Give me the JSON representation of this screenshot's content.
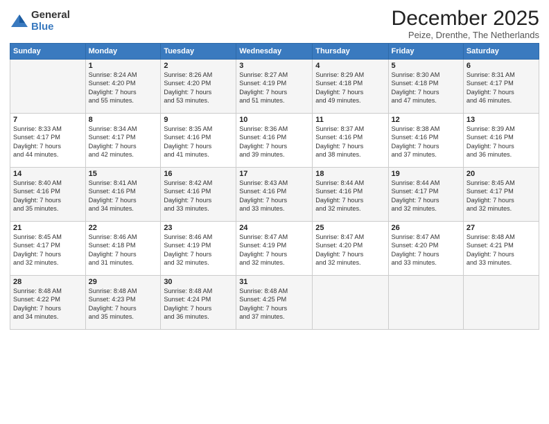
{
  "logo": {
    "general": "General",
    "blue": "Blue"
  },
  "title": "December 2025",
  "location": "Peize, Drenthe, The Netherlands",
  "days_header": [
    "Sunday",
    "Monday",
    "Tuesday",
    "Wednesday",
    "Thursday",
    "Friday",
    "Saturday"
  ],
  "weeks": [
    [
      {
        "day": "",
        "info": ""
      },
      {
        "day": "1",
        "info": "Sunrise: 8:24 AM\nSunset: 4:20 PM\nDaylight: 7 hours\nand 55 minutes."
      },
      {
        "day": "2",
        "info": "Sunrise: 8:26 AM\nSunset: 4:20 PM\nDaylight: 7 hours\nand 53 minutes."
      },
      {
        "day": "3",
        "info": "Sunrise: 8:27 AM\nSunset: 4:19 PM\nDaylight: 7 hours\nand 51 minutes."
      },
      {
        "day": "4",
        "info": "Sunrise: 8:29 AM\nSunset: 4:18 PM\nDaylight: 7 hours\nand 49 minutes."
      },
      {
        "day": "5",
        "info": "Sunrise: 8:30 AM\nSunset: 4:18 PM\nDaylight: 7 hours\nand 47 minutes."
      },
      {
        "day": "6",
        "info": "Sunrise: 8:31 AM\nSunset: 4:17 PM\nDaylight: 7 hours\nand 46 minutes."
      }
    ],
    [
      {
        "day": "7",
        "info": "Sunrise: 8:33 AM\nSunset: 4:17 PM\nDaylight: 7 hours\nand 44 minutes."
      },
      {
        "day": "8",
        "info": "Sunrise: 8:34 AM\nSunset: 4:17 PM\nDaylight: 7 hours\nand 42 minutes."
      },
      {
        "day": "9",
        "info": "Sunrise: 8:35 AM\nSunset: 4:16 PM\nDaylight: 7 hours\nand 41 minutes."
      },
      {
        "day": "10",
        "info": "Sunrise: 8:36 AM\nSunset: 4:16 PM\nDaylight: 7 hours\nand 39 minutes."
      },
      {
        "day": "11",
        "info": "Sunrise: 8:37 AM\nSunset: 4:16 PM\nDaylight: 7 hours\nand 38 minutes."
      },
      {
        "day": "12",
        "info": "Sunrise: 8:38 AM\nSunset: 4:16 PM\nDaylight: 7 hours\nand 37 minutes."
      },
      {
        "day": "13",
        "info": "Sunrise: 8:39 AM\nSunset: 4:16 PM\nDaylight: 7 hours\nand 36 minutes."
      }
    ],
    [
      {
        "day": "14",
        "info": "Sunrise: 8:40 AM\nSunset: 4:16 PM\nDaylight: 7 hours\nand 35 minutes."
      },
      {
        "day": "15",
        "info": "Sunrise: 8:41 AM\nSunset: 4:16 PM\nDaylight: 7 hours\nand 34 minutes."
      },
      {
        "day": "16",
        "info": "Sunrise: 8:42 AM\nSunset: 4:16 PM\nDaylight: 7 hours\nand 33 minutes."
      },
      {
        "day": "17",
        "info": "Sunrise: 8:43 AM\nSunset: 4:16 PM\nDaylight: 7 hours\nand 33 minutes."
      },
      {
        "day": "18",
        "info": "Sunrise: 8:44 AM\nSunset: 4:16 PM\nDaylight: 7 hours\nand 32 minutes."
      },
      {
        "day": "19",
        "info": "Sunrise: 8:44 AM\nSunset: 4:17 PM\nDaylight: 7 hours\nand 32 minutes."
      },
      {
        "day": "20",
        "info": "Sunrise: 8:45 AM\nSunset: 4:17 PM\nDaylight: 7 hours\nand 32 minutes."
      }
    ],
    [
      {
        "day": "21",
        "info": "Sunrise: 8:45 AM\nSunset: 4:17 PM\nDaylight: 7 hours\nand 32 minutes."
      },
      {
        "day": "22",
        "info": "Sunrise: 8:46 AM\nSunset: 4:18 PM\nDaylight: 7 hours\nand 31 minutes."
      },
      {
        "day": "23",
        "info": "Sunrise: 8:46 AM\nSunset: 4:19 PM\nDaylight: 7 hours\nand 32 minutes."
      },
      {
        "day": "24",
        "info": "Sunrise: 8:47 AM\nSunset: 4:19 PM\nDaylight: 7 hours\nand 32 minutes."
      },
      {
        "day": "25",
        "info": "Sunrise: 8:47 AM\nSunset: 4:20 PM\nDaylight: 7 hours\nand 32 minutes."
      },
      {
        "day": "26",
        "info": "Sunrise: 8:47 AM\nSunset: 4:20 PM\nDaylight: 7 hours\nand 33 minutes."
      },
      {
        "day": "27",
        "info": "Sunrise: 8:48 AM\nSunset: 4:21 PM\nDaylight: 7 hours\nand 33 minutes."
      }
    ],
    [
      {
        "day": "28",
        "info": "Sunrise: 8:48 AM\nSunset: 4:22 PM\nDaylight: 7 hours\nand 34 minutes."
      },
      {
        "day": "29",
        "info": "Sunrise: 8:48 AM\nSunset: 4:23 PM\nDaylight: 7 hours\nand 35 minutes."
      },
      {
        "day": "30",
        "info": "Sunrise: 8:48 AM\nSunset: 4:24 PM\nDaylight: 7 hours\nand 36 minutes."
      },
      {
        "day": "31",
        "info": "Sunrise: 8:48 AM\nSunset: 4:25 PM\nDaylight: 7 hours\nand 37 minutes."
      },
      {
        "day": "",
        "info": ""
      },
      {
        "day": "",
        "info": ""
      },
      {
        "day": "",
        "info": ""
      }
    ]
  ]
}
